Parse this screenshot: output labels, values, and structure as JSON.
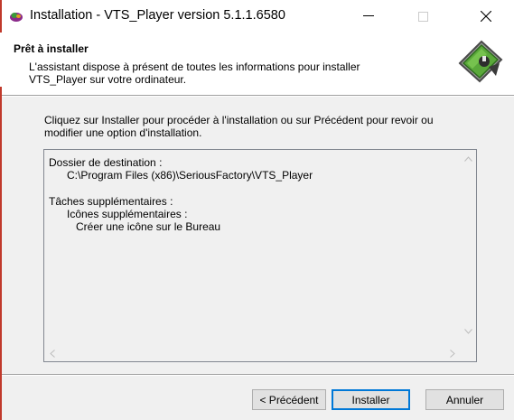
{
  "window": {
    "title": "Installation - VTS_Player version 5.1.1.6580",
    "controls": {
      "minimize": "—",
      "maximize": "☐",
      "close": "✕"
    }
  },
  "header": {
    "title": "Prêt à installer",
    "subtitle_line1": "L'assistant dispose à présent de toutes les informations pour installer",
    "subtitle_line2": "VTS_Player sur votre ordinateur."
  },
  "body": {
    "intro_line1": "Cliquez sur Installer pour procéder à l'installation ou sur Précédent pour revoir ou",
    "intro_line2": "modifier une option d'installation.",
    "memo": {
      "line1": "Dossier de destination :",
      "line2": "      C:\\Program Files (x86)\\SeriousFactory\\VTS_Player",
      "line3": "",
      "line4": "Tâches supplémentaires :",
      "line5": "      Icônes supplémentaires :",
      "line6": "         Créer une icône sur le Bureau"
    }
  },
  "buttons": {
    "back": "< Précédent",
    "install": "Installer",
    "cancel": "Annuler"
  },
  "colors": {
    "dialog_bg": "#f0f0f0",
    "header_bg": "#ffffff",
    "focus_border": "#0078d7",
    "side_marker": "#c0392b"
  }
}
